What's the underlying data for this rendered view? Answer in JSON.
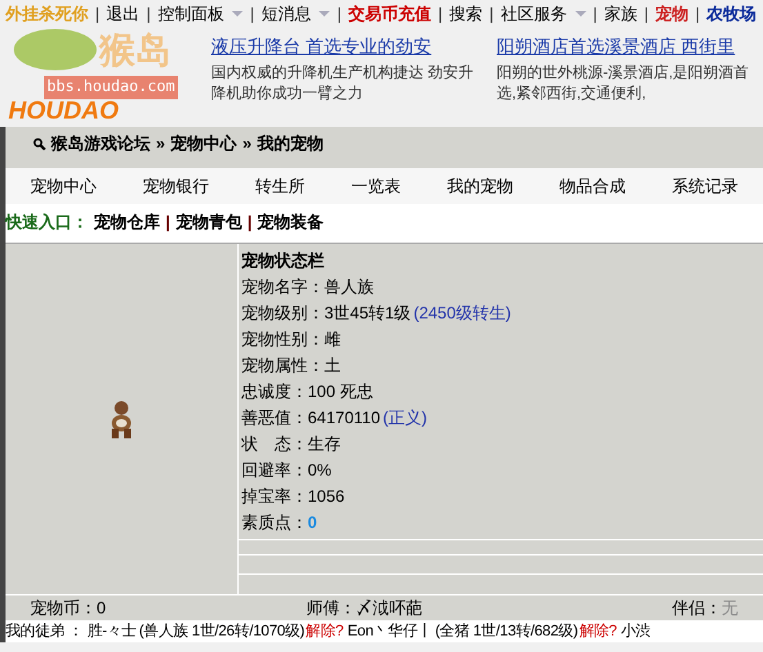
{
  "top_nav_separator": "|",
  "top_nav": [
    {
      "label": "外挂杀死你",
      "color": "#e0a020",
      "dropdown": false
    },
    {
      "label": "退出",
      "color": "#000000",
      "dropdown": false
    },
    {
      "label": "控制面板",
      "color": "#000000",
      "dropdown": true
    },
    {
      "label": "短消息",
      "color": "#000000",
      "dropdown": true
    },
    {
      "label": "交易币充值",
      "color": "#cc0000",
      "dropdown": false
    },
    {
      "label": "搜索",
      "color": "#000000",
      "dropdown": false
    },
    {
      "label": "社区服务",
      "color": "#000000",
      "dropdown": true
    },
    {
      "label": "家族",
      "color": "#000000",
      "dropdown": false
    },
    {
      "label": "宠物",
      "color": "#cc2222",
      "dropdown": false
    },
    {
      "label": "农牧场",
      "color": "#0a2a9a",
      "dropdown": false
    }
  ],
  "logo": {
    "name": "猴岛",
    "url": "bbs.houdao.com",
    "wordmark": "HOUDAO"
  },
  "ads": [
    {
      "title": "液压升降台 首选专业的劲安",
      "text": "国内权威的升降机生产机构捷达 劲安升降机助你成功一臂之力"
    },
    {
      "title": "阳朔酒店首选溪景酒店 西街里",
      "text": "阳朔的世外桃源-溪景酒店,是阳朔酒首选,紧邻西街,交通便利,"
    }
  ],
  "breadcrumb": {
    "separator": "»",
    "items": [
      "猴岛游戏论坛",
      "宠物中心",
      "我的宠物"
    ]
  },
  "tabs": [
    "宠物中心",
    "宠物银行",
    "转生所",
    "一览表",
    "我的宠物",
    "物品合成",
    "系统记录"
  ],
  "quick_links": {
    "label": "快速入口：",
    "separator": "|",
    "links": [
      "宠物仓库",
      "宠物青包",
      "宠物装备"
    ]
  },
  "status_panel": {
    "title": "宠物状态栏",
    "rows": [
      {
        "label": "宠物名字：",
        "value": "兽人族"
      },
      {
        "label": "宠物级别：",
        "value": "3世45转1级",
        "note": "(2450级转生)"
      },
      {
        "label": "宠物性别：",
        "value": "雌"
      },
      {
        "label": "宠物属性：",
        "value": "土"
      },
      {
        "label": "忠诚度：",
        "value": "100 死忠"
      },
      {
        "label": "善恶值：",
        "value": "64170110",
        "note": "(正义)"
      },
      {
        "label": "状　态：",
        "value": "生存"
      },
      {
        "label": "回避率：",
        "value": "0%"
      },
      {
        "label": "掉宝率：",
        "value": "1056"
      },
      {
        "label": "素质点：",
        "value": "0",
        "highlight": true
      }
    ]
  },
  "footer": {
    "coins": "宠物币：0",
    "master": "师傅：〆泧吥葩",
    "partner_label": "伴侣：",
    "partner": "无",
    "partner_disabled": true
  },
  "disciples": {
    "label": "我的徒弟 ：",
    "items": [
      {
        "name": "胜-々士",
        "info": "(兽人族 1世/26转/1070级)",
        "action": "解除?"
      },
      {
        "name": "Eon丶华仔丨",
        "info": "(全猪 1世/13转/682级)",
        "action": "解除?"
      },
      {
        "name": "小渋"
      }
    ]
  }
}
